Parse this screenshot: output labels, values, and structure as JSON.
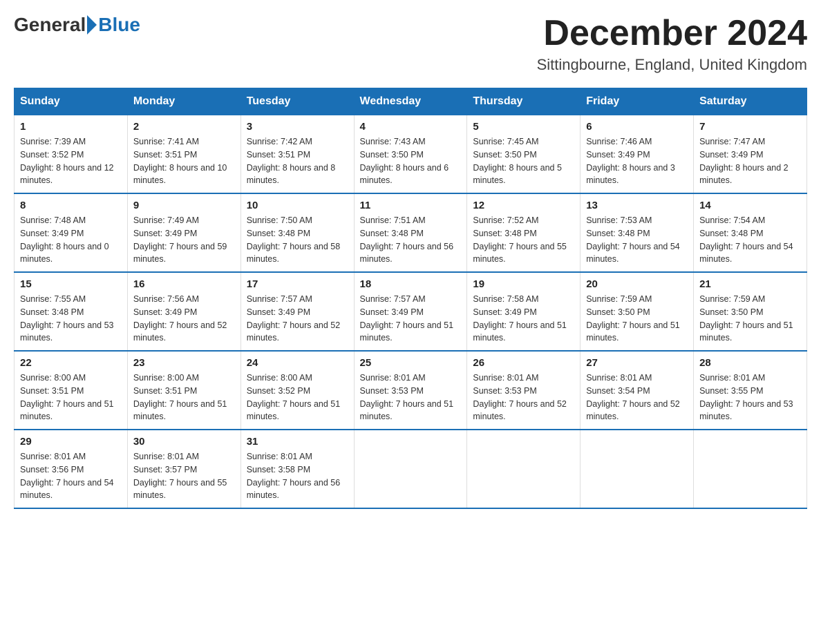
{
  "header": {
    "logo_general": "General",
    "logo_blue": "Blue",
    "month_title": "December 2024",
    "location": "Sittingbourne, England, United Kingdom"
  },
  "days_of_week": [
    "Sunday",
    "Monday",
    "Tuesday",
    "Wednesday",
    "Thursday",
    "Friday",
    "Saturday"
  ],
  "weeks": [
    [
      {
        "day": "1",
        "sunrise": "7:39 AM",
        "sunset": "3:52 PM",
        "daylight": "8 hours and 12 minutes."
      },
      {
        "day": "2",
        "sunrise": "7:41 AM",
        "sunset": "3:51 PM",
        "daylight": "8 hours and 10 minutes."
      },
      {
        "day": "3",
        "sunrise": "7:42 AM",
        "sunset": "3:51 PM",
        "daylight": "8 hours and 8 minutes."
      },
      {
        "day": "4",
        "sunrise": "7:43 AM",
        "sunset": "3:50 PM",
        "daylight": "8 hours and 6 minutes."
      },
      {
        "day": "5",
        "sunrise": "7:45 AM",
        "sunset": "3:50 PM",
        "daylight": "8 hours and 5 minutes."
      },
      {
        "day": "6",
        "sunrise": "7:46 AM",
        "sunset": "3:49 PM",
        "daylight": "8 hours and 3 minutes."
      },
      {
        "day": "7",
        "sunrise": "7:47 AM",
        "sunset": "3:49 PM",
        "daylight": "8 hours and 2 minutes."
      }
    ],
    [
      {
        "day": "8",
        "sunrise": "7:48 AM",
        "sunset": "3:49 PM",
        "daylight": "8 hours and 0 minutes."
      },
      {
        "day": "9",
        "sunrise": "7:49 AM",
        "sunset": "3:49 PM",
        "daylight": "7 hours and 59 minutes."
      },
      {
        "day": "10",
        "sunrise": "7:50 AM",
        "sunset": "3:48 PM",
        "daylight": "7 hours and 58 minutes."
      },
      {
        "day": "11",
        "sunrise": "7:51 AM",
        "sunset": "3:48 PM",
        "daylight": "7 hours and 56 minutes."
      },
      {
        "day": "12",
        "sunrise": "7:52 AM",
        "sunset": "3:48 PM",
        "daylight": "7 hours and 55 minutes."
      },
      {
        "day": "13",
        "sunrise": "7:53 AM",
        "sunset": "3:48 PM",
        "daylight": "7 hours and 54 minutes."
      },
      {
        "day": "14",
        "sunrise": "7:54 AM",
        "sunset": "3:48 PM",
        "daylight": "7 hours and 54 minutes."
      }
    ],
    [
      {
        "day": "15",
        "sunrise": "7:55 AM",
        "sunset": "3:48 PM",
        "daylight": "7 hours and 53 minutes."
      },
      {
        "day": "16",
        "sunrise": "7:56 AM",
        "sunset": "3:49 PM",
        "daylight": "7 hours and 52 minutes."
      },
      {
        "day": "17",
        "sunrise": "7:57 AM",
        "sunset": "3:49 PM",
        "daylight": "7 hours and 52 minutes."
      },
      {
        "day": "18",
        "sunrise": "7:57 AM",
        "sunset": "3:49 PM",
        "daylight": "7 hours and 51 minutes."
      },
      {
        "day": "19",
        "sunrise": "7:58 AM",
        "sunset": "3:49 PM",
        "daylight": "7 hours and 51 minutes."
      },
      {
        "day": "20",
        "sunrise": "7:59 AM",
        "sunset": "3:50 PM",
        "daylight": "7 hours and 51 minutes."
      },
      {
        "day": "21",
        "sunrise": "7:59 AM",
        "sunset": "3:50 PM",
        "daylight": "7 hours and 51 minutes."
      }
    ],
    [
      {
        "day": "22",
        "sunrise": "8:00 AM",
        "sunset": "3:51 PM",
        "daylight": "7 hours and 51 minutes."
      },
      {
        "day": "23",
        "sunrise": "8:00 AM",
        "sunset": "3:51 PM",
        "daylight": "7 hours and 51 minutes."
      },
      {
        "day": "24",
        "sunrise": "8:00 AM",
        "sunset": "3:52 PM",
        "daylight": "7 hours and 51 minutes."
      },
      {
        "day": "25",
        "sunrise": "8:01 AM",
        "sunset": "3:53 PM",
        "daylight": "7 hours and 51 minutes."
      },
      {
        "day": "26",
        "sunrise": "8:01 AM",
        "sunset": "3:53 PM",
        "daylight": "7 hours and 52 minutes."
      },
      {
        "day": "27",
        "sunrise": "8:01 AM",
        "sunset": "3:54 PM",
        "daylight": "7 hours and 52 minutes."
      },
      {
        "day": "28",
        "sunrise": "8:01 AM",
        "sunset": "3:55 PM",
        "daylight": "7 hours and 53 minutes."
      }
    ],
    [
      {
        "day": "29",
        "sunrise": "8:01 AM",
        "sunset": "3:56 PM",
        "daylight": "7 hours and 54 minutes."
      },
      {
        "day": "30",
        "sunrise": "8:01 AM",
        "sunset": "3:57 PM",
        "daylight": "7 hours and 55 minutes."
      },
      {
        "day": "31",
        "sunrise": "8:01 AM",
        "sunset": "3:58 PM",
        "daylight": "7 hours and 56 minutes."
      },
      null,
      null,
      null,
      null
    ]
  ]
}
